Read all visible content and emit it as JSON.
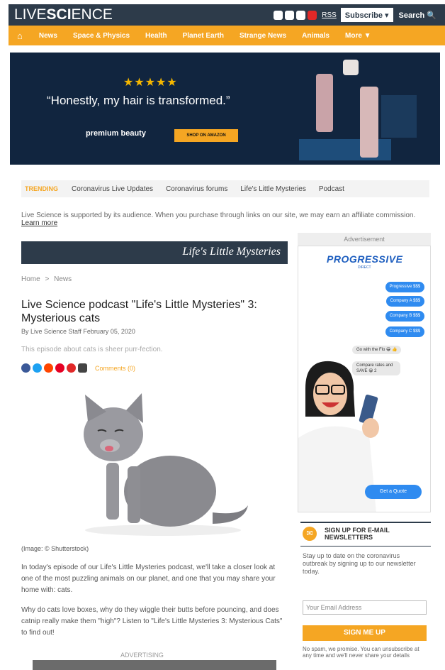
{
  "header": {
    "logo_live": "LIVE",
    "logo_science": "SCI",
    "logo_ence": "ENCE",
    "rss": "RSS",
    "subscribe": "Subscribe ▾",
    "search": "Search 🔍"
  },
  "nav": {
    "home_icon": "⌂",
    "items": [
      "News",
      "Space & Physics",
      "Health",
      "Planet Earth",
      "Strange News",
      "Animals",
      "More ▼"
    ]
  },
  "ad_banner": {
    "stars": "★★★★★",
    "quote": "“Honestly, my hair is transformed.”",
    "brand": "premium beauty",
    "cta": "SHOP ON AMAZON"
  },
  "trending": {
    "label": "TRENDING",
    "items": [
      "Coronavirus Live Updates",
      "Coronavirus forums",
      "Life's Little Mysteries",
      "Podcast"
    ]
  },
  "affiliate": {
    "text": "Live Science is supported by its audience. When you purchase through links on our site, we may earn an affiliate commission.",
    "link": "Learn more"
  },
  "article": {
    "banner": "Life's Little Mysteries",
    "breadcrumb_home": "Home",
    "breadcrumb_sep": ">",
    "breadcrumb_news": "News",
    "title": "Live Science podcast \"Life's Little Mysteries\" 3: Mysterious cats",
    "byline": "By Live Science Staff  February 05, 2020",
    "subtitle": "This episode about cats is sheer purr-fection.",
    "comments": "Comments (0)",
    "caption": "(Image: © Shutterstock)",
    "para1": "In today's episode of our Life's Little Mysteries podcast, we'll take a closer look at one of the most puzzling animals on our planet, and one that you may share your home with: cats.",
    "para2": "Why do cats love boxes, why do they wiggle their butts before pouncing, and does catnip really make them \"high\"? Listen to \"Life's Little Mysteries 3: Mysterious Cats\" to find out!",
    "advertising": "ADVERTISING"
  },
  "sidebar_ad": {
    "label": "Advertisement",
    "logo": "PROGRESSIVE",
    "logo_sub": "DIRECT",
    "bubbles": [
      "Progressive $$$",
      "Company A $$$",
      "Company B $$$",
      "Company C $$$"
    ],
    "gray1": "Go with the Flo 😁 👍",
    "gray2": "Compare rates and SAVE 😀 2",
    "cta": "Get a Quote"
  },
  "newsletter": {
    "icon": "✉",
    "title": "SIGN UP FOR E-MAIL NEWSLETTERS",
    "desc": "Stay up to date on the coronavirus outbreak by signing up to our newsletter today.",
    "placeholder": "Your Email Address",
    "button": "SIGN ME UP",
    "fine": "No spam, we promise. You can unsubscribe at any time and we'll never share your details"
  },
  "colors": {
    "brand_dark": "#2d3b4a",
    "accent": "#f5a623",
    "link_blue": "#2f8bf0"
  }
}
